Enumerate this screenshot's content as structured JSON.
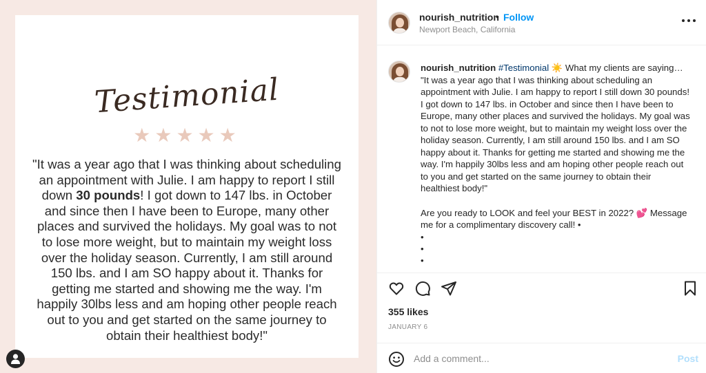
{
  "media": {
    "title": "Testimonial",
    "stars": "★★★★★",
    "rating": 5,
    "quote_pre": "\"It was a year ago that I was thinking about scheduling an appointment with Julie. I am happy to report I still down ",
    "quote_bold": "30 pounds",
    "quote_post": "! I got down to 147 lbs. in October and since then I have been to Europe, many other places and survived the holidays. My goal was to not to lose more weight, but to maintain my weight loss over the holiday season. Currently, I am still around 150 lbs. and I am SO happy about it. Thanks for getting me started and showing me the way. I'm happily 30lbs less and am hoping other people reach out to you and get started on the same journey to obtain their healthiest body!\"",
    "tag_icon": "user-tag-icon"
  },
  "header": {
    "username": "nourish_nutrition",
    "separator": "•",
    "follow": "Follow",
    "location": "Newport Beach, California",
    "more_icon": "more-options-icon"
  },
  "caption": {
    "username": "nourish_nutrition",
    "hashtag": "#Testimonial",
    "sun_emoji": "☀️",
    "intro": "What my clients are saying…",
    "quote": "\"It was a year ago that I was thinking about scheduling an appointment with Julie. I am happy to report I still down 30 pounds! I got down to 147 lbs. in October and since then I have been to Europe, many other places and survived the holidays. My goal was to not to lose more weight, but to maintain my weight loss over the holiday season. Currently, I am still around 150 lbs. and I am SO happy about it. Thanks for getting me started and showing me the way. I'm happily 30lbs less and am hoping other people reach out to you and get started on the same journey to obtain their healthiest body!\"",
    "cta_pre": "Are you ready to LOOK and feel your BEST in 2022?",
    "cta_emoji": "💕",
    "cta_post": "Message me for a complimentary discovery call! •",
    "bullets": [
      "•",
      "•",
      "•"
    ]
  },
  "actions": {
    "like_icon": "heart-icon",
    "comment_icon": "comment-icon",
    "share_icon": "share-icon",
    "save_icon": "bookmark-icon"
  },
  "stats": {
    "likes": "355 likes",
    "date": "JANUARY 6"
  },
  "comment": {
    "placeholder": "Add a comment...",
    "post": "Post",
    "emoji_icon": "emoji-icon"
  },
  "colors": {
    "accent": "#0095f6",
    "post_disabled": "#b2dffc",
    "media_bg": "#f7e9e4",
    "stars": "#e9c9bb"
  }
}
